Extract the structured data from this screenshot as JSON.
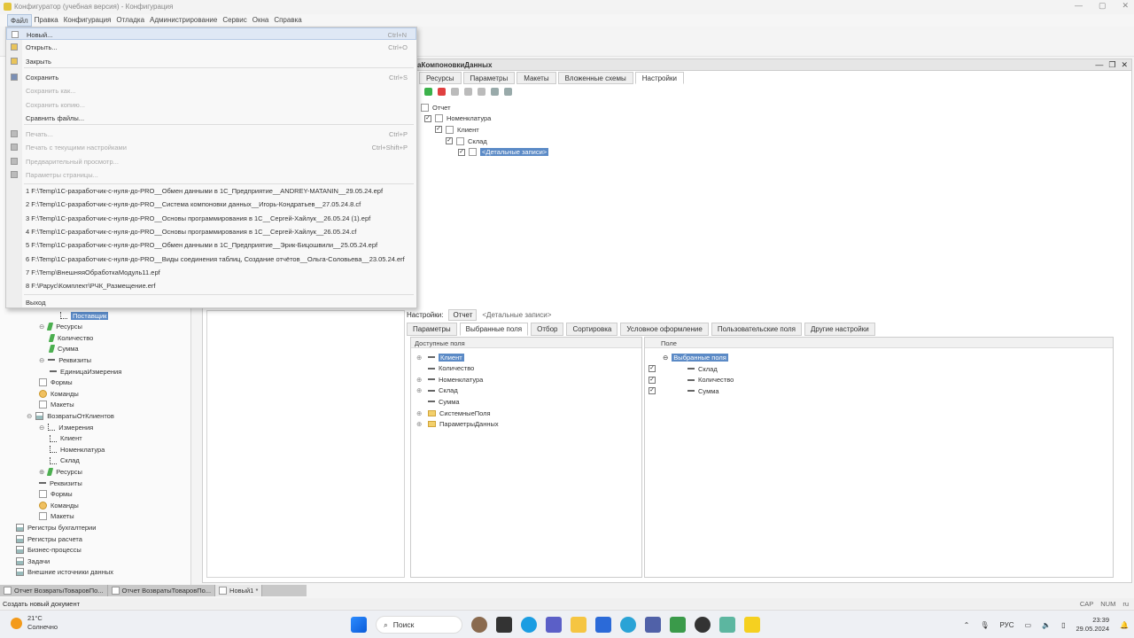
{
  "window": {
    "title": "Конфигуратор (учебная версия) - Конфигурация"
  },
  "menubar": [
    "Файл",
    "Правка",
    "Конфигурация",
    "Отладка",
    "Администрирование",
    "Сервис",
    "Окна",
    "Справка"
  ],
  "file_menu": {
    "items": [
      {
        "label": "Новый...",
        "shortcut": "Ctrl+N",
        "disabled": false,
        "highlight": true
      },
      {
        "label": "Открыть...",
        "shortcut": "Ctrl+O",
        "disabled": false
      },
      {
        "label": "Закрыть",
        "shortcut": "",
        "disabled": false
      },
      {
        "label": "Сохранить",
        "shortcut": "Ctrl+S",
        "disabled": false
      },
      {
        "label": "Сохранить как...",
        "shortcut": "",
        "disabled": true
      },
      {
        "label": "Сохранить копию...",
        "shortcut": "",
        "disabled": true
      },
      {
        "label": "Сравнить файлы...",
        "shortcut": "",
        "disabled": false
      },
      {
        "label": "Печать...",
        "shortcut": "Ctrl+P",
        "disabled": true
      },
      {
        "label": "Печать с текущими настройками",
        "shortcut": "Ctrl+Shift+P",
        "disabled": true
      },
      {
        "label": "Предварительный просмотр...",
        "shortcut": "",
        "disabled": true
      },
      {
        "label": "Параметры страницы...",
        "shortcut": "",
        "disabled": true
      }
    ],
    "recent": [
      "1 F:\\Temp\\1C-разработчик-с-нуля-до-PRO__Обмен данными в 1С_Предприятие__ANDREY-MATANIN__29.05.24.epf",
      "2 F:\\Temp\\1C-разработчик-с-нуля-до-PRO__Система компоновки данных__Игорь-Кондратьев__27.05.24.8.cf",
      "3 F:\\Temp\\1C-разработчик-с-нуля-до-PRO__Основы программирования в 1С__Сергей-Хайлук__26.05.24 (1).epf",
      "4 F:\\Temp\\1C-разработчик-с-нуля-до-PRO__Основы программирования в 1С__Сергей-Хайлук__26.05.24.cf",
      "5 F:\\Temp\\1C-разработчик-с-нуля-до-PRO__Обмен данными в 1С_Предприятие__Эрик-Бицошвили__25.05.24.epf",
      "6 F:\\Temp\\1C-разработчик-с-нуля-до-PRO__Виды соединения таблиц, Создание отчётов__Ольга-Соловьева__23.05.24.erf",
      "7 F:\\Temp\\ВнешняяОбработкаМодуль11.epf",
      "8 F:\\Рарус\\Комплект\\РЧК_Размещение.erf"
    ],
    "exit": "Выход"
  },
  "editor": {
    "title": "аКомпоновкиДанных",
    "tabs": [
      "Ресурсы",
      "Параметры",
      "Макеты",
      "Вложенные схемы",
      "Настройки"
    ],
    "active_tab": "Настройки",
    "structure": [
      "Отчет",
      "Номенклатура",
      "Клиент",
      "Склад",
      "<Детальные записи>"
    ],
    "settings_label": "Настройки:",
    "settings_chip": "Отчет",
    "settings_path": "<Детальные записи>",
    "subtabs": [
      "Параметры",
      "Выбранные поля",
      "Отбор",
      "Сортировка",
      "Условное оформление",
      "Пользовательские поля",
      "Другие настройки"
    ],
    "active_subtab": "Выбранные поля",
    "available_header": "Доступные поля",
    "available_fields": [
      "Клиент",
      "Количество",
      "Номенклатура",
      "Склад",
      "Сумма",
      "СистемныеПоля",
      "ПараметрыДанных"
    ],
    "selected_header": "Поле",
    "selected_root": "Выбранные поля",
    "selected_fields": [
      "Склад",
      "Количество",
      "Сумма"
    ]
  },
  "left_tree": [
    {
      "label": "Поставщик",
      "indent": 68,
      "icon": "dim",
      "selected": true
    },
    {
      "label": "Ресурсы",
      "indent": 44,
      "icon": "green",
      "exp": "⊖"
    },
    {
      "label": "Количество",
      "indent": 56,
      "icon": "green"
    },
    {
      "label": "Сумма",
      "indent": 56,
      "icon": "green"
    },
    {
      "label": "Реквизиты",
      "indent": 44,
      "icon": "dash",
      "exp": "⊖"
    },
    {
      "label": "ЕдиницаИзмерения",
      "indent": 56,
      "icon": "dash"
    },
    {
      "label": "Формы",
      "indent": 44,
      "icon": "doc"
    },
    {
      "label": "Команды",
      "indent": 44,
      "icon": "cmd"
    },
    {
      "label": "Макеты",
      "indent": 44,
      "icon": "doc"
    },
    {
      "label": "ВозвратыОтКлиентов",
      "indent": 30,
      "icon": "reg",
      "exp": "⊖"
    },
    {
      "label": "Измерения",
      "indent": 44,
      "icon": "dim",
      "exp": "⊖"
    },
    {
      "label": "Клиент",
      "indent": 56,
      "icon": "dim"
    },
    {
      "label": "Номенклатура",
      "indent": 56,
      "icon": "dim"
    },
    {
      "label": "Склад",
      "indent": 56,
      "icon": "dim"
    },
    {
      "label": "Ресурсы",
      "indent": 44,
      "icon": "green",
      "exp": "⊕"
    },
    {
      "label": "Реквизиты",
      "indent": 44,
      "icon": "dash"
    },
    {
      "label": "Формы",
      "indent": 44,
      "icon": "doc"
    },
    {
      "label": "Команды",
      "indent": 44,
      "icon": "cmd"
    },
    {
      "label": "Макеты",
      "indent": 44,
      "icon": "doc"
    },
    {
      "label": "Регистры бухгалтерии",
      "indent": 18,
      "icon": "reg"
    },
    {
      "label": "Регистры расчета",
      "indent": 18,
      "icon": "reg"
    },
    {
      "label": "Бизнес-процессы",
      "indent": 18,
      "icon": "reg"
    },
    {
      "label": "Задачи",
      "indent": 18,
      "icon": "reg"
    },
    {
      "label": "Внешние источники данных",
      "indent": 18,
      "icon": "reg"
    }
  ],
  "task_tabs": [
    "Отчет ВозвратыТоваровПо...",
    "Отчет ВозвратыТоваровПо...",
    "Новый1 *"
  ],
  "status": {
    "text": "Создать новый документ",
    "indicators": [
      "CAP",
      "NUM",
      "ru"
    ]
  },
  "taskbar": {
    "weather_temp": "21°C",
    "weather_desc": "Солнечно",
    "search": "Поиск",
    "lang": "РУС",
    "time": "23:39",
    "date": "29.05.2024"
  }
}
